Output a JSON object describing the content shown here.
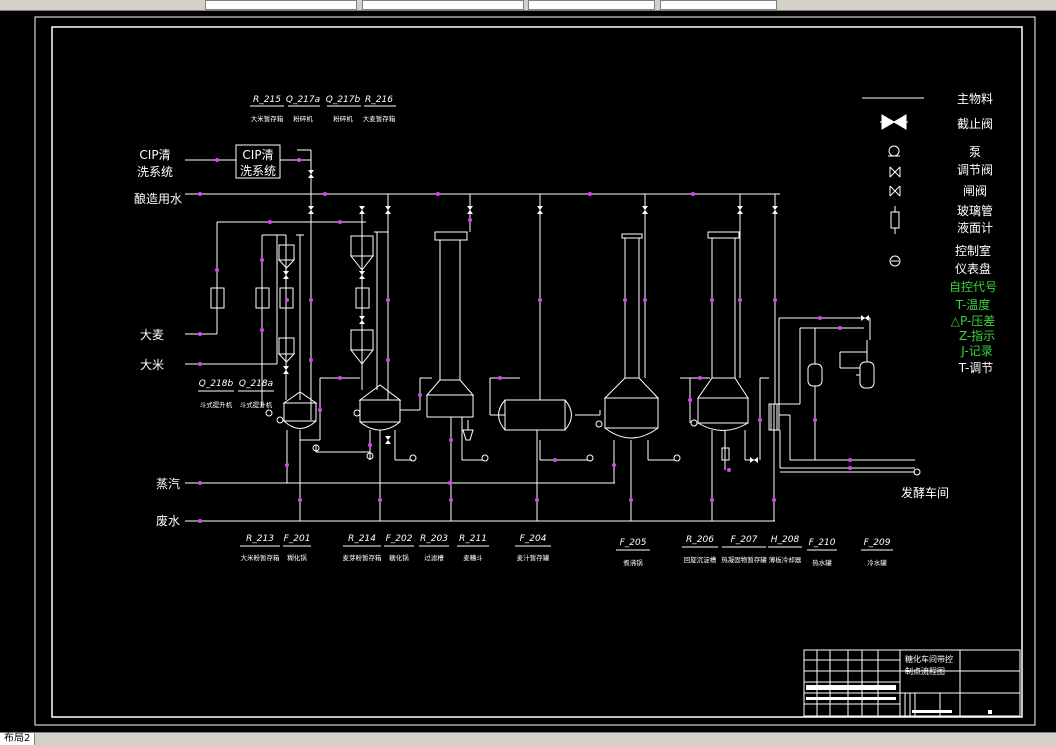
{
  "drawing_tab": "布局2",
  "title_block": {
    "title_line1": "糖化车间带控",
    "title_line2": "制点流程图"
  },
  "legend": {
    "items": [
      {
        "label": "主物料"
      },
      {
        "label": "截止阀"
      },
      {
        "label": "泵"
      },
      {
        "label": "调节阀"
      },
      {
        "label": "闸阀"
      },
      {
        "label": "玻璃管"
      },
      {
        "label": "液面计"
      },
      {
        "label": "控制室"
      },
      {
        "label": "仪表盘"
      }
    ],
    "control_codes": [
      {
        "label": "自控代号",
        "color": "#39d33b"
      },
      {
        "label": "T-温度",
        "color": "#39d33b"
      },
      {
        "label": "△P-压差",
        "color": "#39d33b"
      },
      {
        "label": "Z-指示",
        "color": "#39d33b"
      },
      {
        "label": "J-记录",
        "color": "#39d33b"
      },
      {
        "label": "T-调节",
        "color": "#ffffff"
      }
    ]
  },
  "streams": {
    "cip_left_1": "CIP清",
    "cip_left_2": "洗系统",
    "cip_box_1": "CIP清",
    "cip_box_2": "洗系统",
    "brew_water": "酿造用水",
    "barley": "大麦",
    "rice": "大米",
    "steam": "蒸汽",
    "waste_water": "废水",
    "fermentation": "发酵车间"
  },
  "top_tags": [
    {
      "code": "R_215",
      "name": "大米暂存箱"
    },
    {
      "code": "Q_217a",
      "name": "粉碎机"
    },
    {
      "code": "Q_217b",
      "name": "粉碎机"
    },
    {
      "code": "R_216",
      "name": "大麦暂存箱"
    }
  ],
  "mid_tags": [
    {
      "code": "Q_218b",
      "name": "斗式提升机"
    },
    {
      "code": "Q_218a",
      "name": "斗式提升机"
    }
  ],
  "bottom_tags": [
    {
      "code": "R_213",
      "name": "大米粉暂存箱"
    },
    {
      "code": "F_201",
      "name": "糊化锅"
    },
    {
      "code": "R_214",
      "name": "麦芽粉暂存箱"
    },
    {
      "code": "F_202",
      "name": "糖化锅"
    },
    {
      "code": "R_203",
      "name": "过滤槽"
    },
    {
      "code": "R_211",
      "name": "麦糟斗"
    },
    {
      "code": "F_204",
      "name": "麦汁暂存罐"
    },
    {
      "code": "F_205",
      "name": "煮沸锅"
    },
    {
      "code": "R_206",
      "name": "回旋沉淀槽"
    },
    {
      "code": "F_207",
      "name": "热凝固物暂存罐"
    },
    {
      "code": "H_208",
      "name": "薄板冷却器"
    },
    {
      "code": "F_210",
      "name": "热水罐"
    },
    {
      "code": "F_209",
      "name": "冷水罐"
    }
  ]
}
